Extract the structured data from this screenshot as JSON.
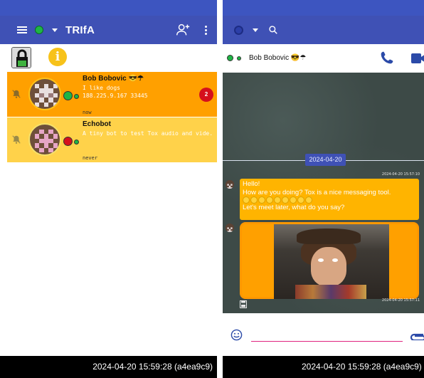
{
  "colors": {
    "appbar": "#3f51b5",
    "statusbar": "#3d55c0",
    "contact_primary": "#ffa000",
    "contact_secondary": "#ffd24a",
    "online": "#1fb545",
    "offline": "#d5101c",
    "unread_badge": "#d5101c",
    "date_pill": "#3f51b5",
    "message_bubble": "#ffb400",
    "chat_background": "#3d4a47",
    "input_underline": "#e0237f"
  },
  "left": {
    "app_title": "TRIfA",
    "own_status": "online",
    "toolbar_icons": [
      "menu-icon",
      "add-friend-icon",
      "overflow-menu-icon",
      "lock-icon",
      "info-icon"
    ],
    "contacts": [
      {
        "name": "Bob Bobovic 😎☂",
        "message": "I like dogs",
        "address": "188.225.9.167 33445",
        "last_seen": "now",
        "status": "online",
        "unread": "2"
      },
      {
        "name": "Echobot",
        "message": "A tiny bot to test Tox audio and vide.",
        "address": "",
        "last_seen": "never",
        "status": "offline",
        "unread": ""
      }
    ],
    "footer": "2024-04-20 15:59:28 (a4ea9c9)"
  },
  "right": {
    "own_status": "none",
    "toolbar_icons": [
      "search-icon",
      "phone-icon",
      "video-icon",
      "smiley-icon",
      "attach-icon",
      "save-icon"
    ],
    "contact_name": "Bob Bobovic 😎☂",
    "date_separator": "2024-04-20",
    "messages": [
      {
        "timestamp": "2024-04-20 15:57:10",
        "lines": [
          "Hello!",
          "How are you doing? Tox is a nice messaging tool.",
          "Let's meet later, what do you say?"
        ],
        "emoji_count": 9
      },
      {
        "timestamp": "2024-04-20 15:57:11",
        "kind": "image"
      }
    ],
    "footer": "2024-04-20 15:59:28 (a4ea9c9)"
  }
}
